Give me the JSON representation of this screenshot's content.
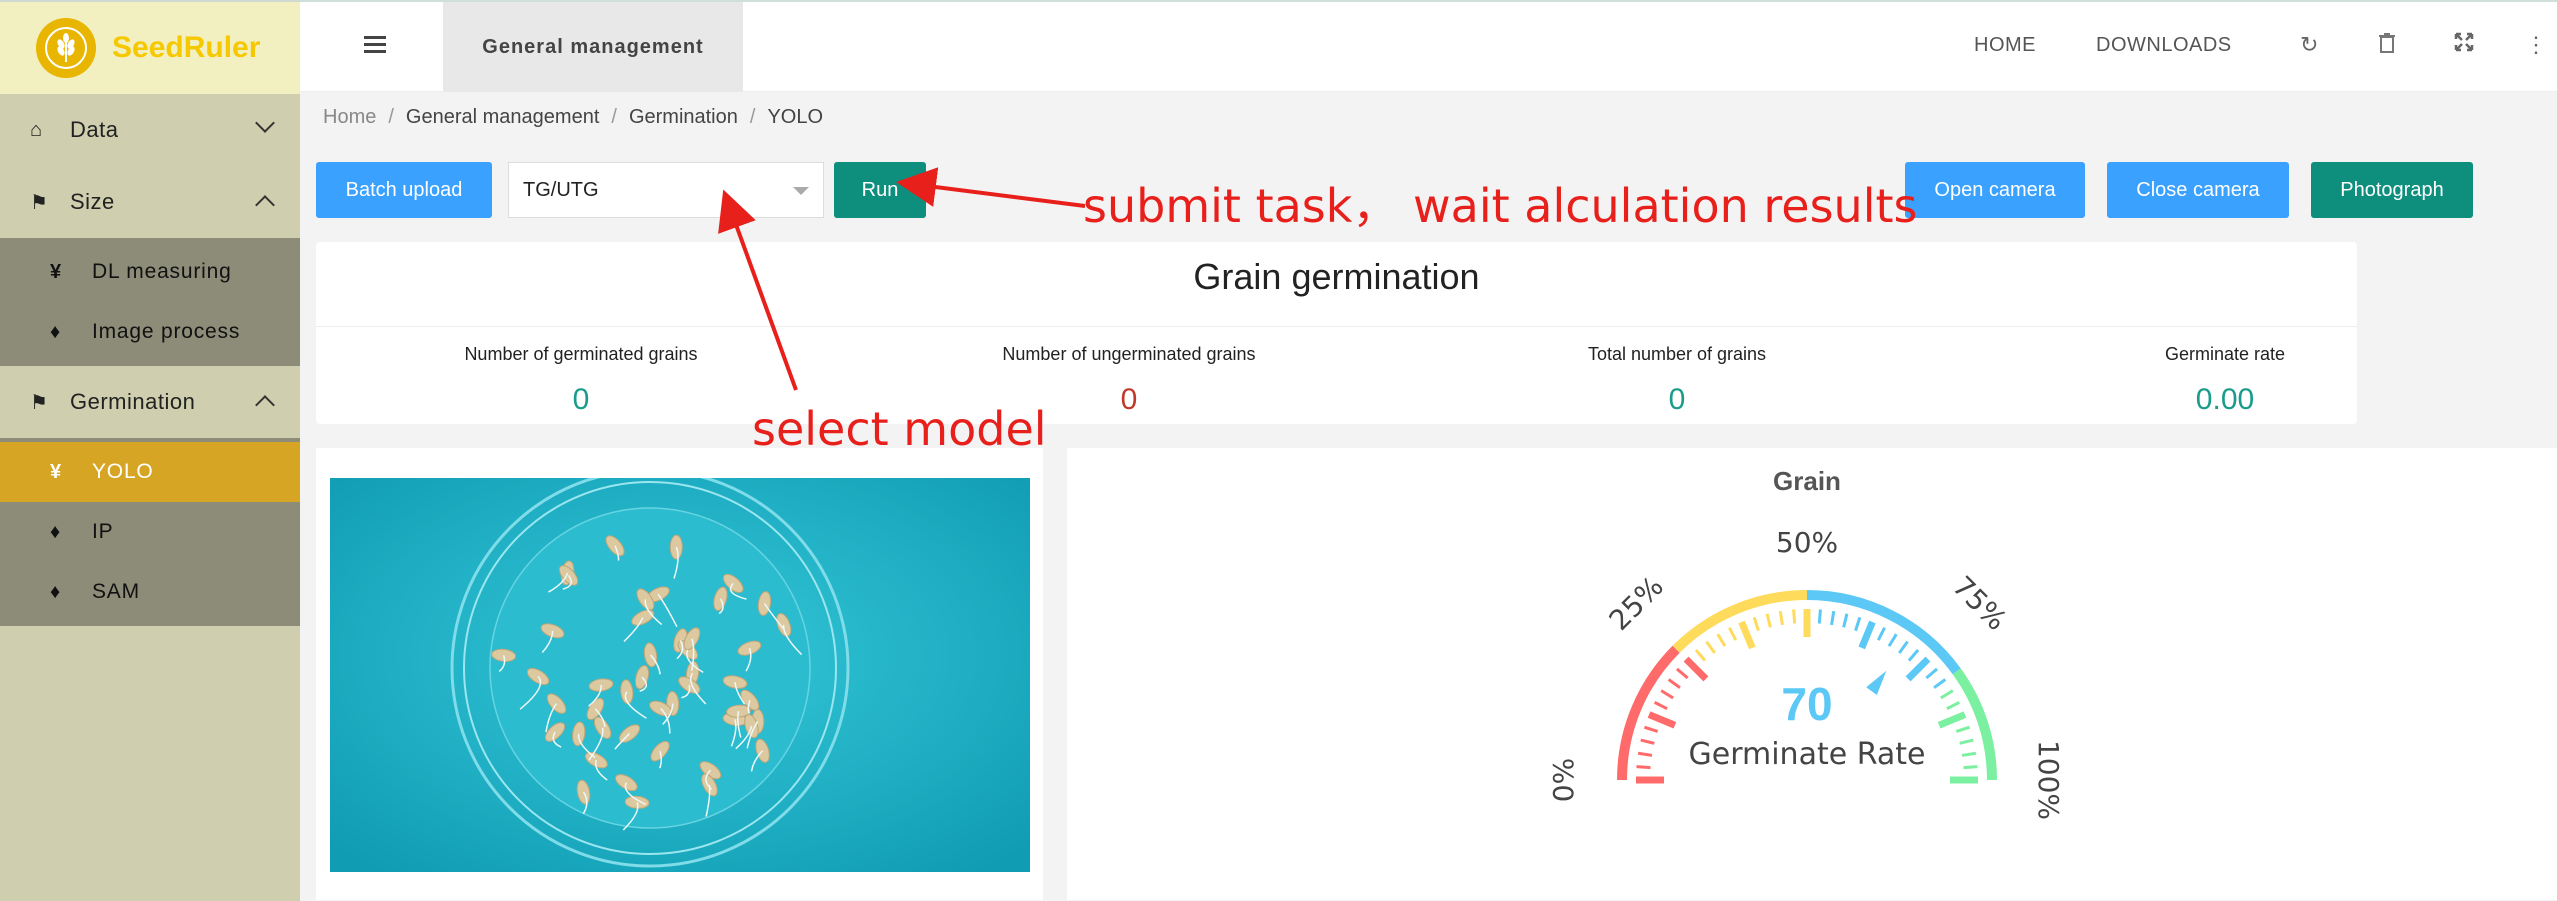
{
  "brand": {
    "name": "SeedRuler",
    "logo_icon": "wheat-icon"
  },
  "sidebar": {
    "groups": [
      {
        "label": "Data",
        "icon": "home-icon",
        "expanded": false
      },
      {
        "label": "Size",
        "icon": "flag-icon",
        "expanded": true,
        "items": [
          {
            "label": "DL measuring",
            "icon": "currency-icon"
          },
          {
            "label": "Image process",
            "icon": "tags-icon"
          }
        ]
      },
      {
        "label": "Germination",
        "icon": "flag-icon",
        "expanded": true,
        "items": [
          {
            "label": "YOLO",
            "icon": "currency-icon",
            "active": true
          },
          {
            "label": "IP",
            "icon": "tags-icon"
          },
          {
            "label": "SAM",
            "icon": "tags-icon"
          }
        ]
      }
    ]
  },
  "header": {
    "active_tab": "General management",
    "links": [
      "HOME",
      "DOWNLOADS"
    ],
    "icons": [
      "refresh-icon",
      "trash-icon",
      "fullscreen-icon",
      "more-icon"
    ]
  },
  "breadcrumb": [
    "Home",
    "General management",
    "Germination",
    "YOLO"
  ],
  "toolbar": {
    "batch_upload": "Batch upload",
    "model_select": "TG/UTG",
    "run": "Run",
    "open_camera": "Open camera",
    "close_camera": "Close camera",
    "photograph": "Photograph"
  },
  "stats": {
    "title": "Grain germination",
    "items": [
      {
        "label": "Number of germinated grains",
        "value": "0",
        "color": "#1a9c8c"
      },
      {
        "label": "Number of ungerminated grains",
        "value": "0",
        "color": "#c0392b"
      },
      {
        "label": "Total number of grains",
        "value": "0",
        "color": "#1a9c8c"
      },
      {
        "label": "Germinate rate",
        "value": "0.00",
        "color": "#1a9c8c"
      }
    ]
  },
  "gauge": {
    "title": "Grain",
    "value": "70",
    "label": "Germinate Rate",
    "ticks": [
      "0%",
      "25%",
      "50%",
      "75%",
      "100%"
    ],
    "colors": {
      "red": "#ff6b6b",
      "yellow": "#ffdb5c",
      "blue": "#5bc8f5",
      "green": "#7bf0a0"
    }
  },
  "annotations": {
    "submit": "submit task， wait alculation results",
    "select": "select model"
  }
}
